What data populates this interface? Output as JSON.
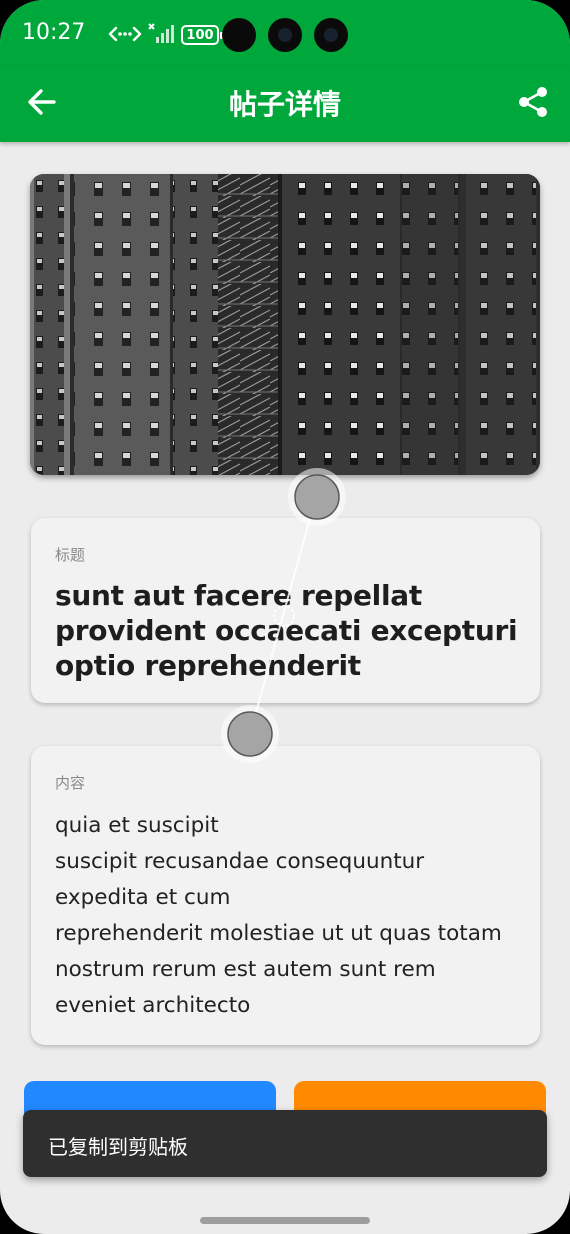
{
  "status_bar": {
    "time": "10:27",
    "battery": "100"
  },
  "app_bar": {
    "title": "帖子详情",
    "back_icon": "arrow-back-icon",
    "share_icon": "share-icon"
  },
  "post": {
    "title_label": "标题",
    "title": "sunt aut facere repellat provident occaecati excepturi optio reprehenderit",
    "content_label": "内容",
    "content_lines": [
      "quia et suscipit",
      "suscipit recusandae consequuntur",
      "expedita et cum",
      "reprehenderit molestiae ut ut quas totam",
      "nostrum rerum est autem sunt rem",
      "eveniet architecto"
    ]
  },
  "toast": {
    "message": "已复制到剪贴板"
  },
  "colors": {
    "app_bar": "#00a83c",
    "copy_button": "#2188ff",
    "delete_button": "#ff8a00",
    "toast": "#2f2f2f"
  }
}
